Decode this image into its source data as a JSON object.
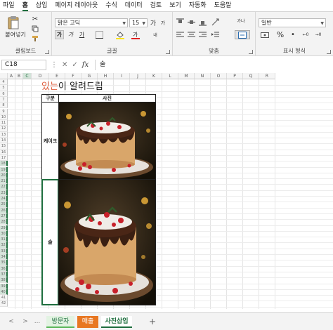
{
  "menu": [
    "파일",
    "홈",
    "삽입",
    "페이지 레이아웃",
    "수식",
    "데이터",
    "검토",
    "보기",
    "자동화",
    "도움말"
  ],
  "ribbon": {
    "clipboard_label": "클립보드",
    "paste_label": "붙여넣기",
    "font_label": "글꼴",
    "font_name": "맑은 고딕",
    "font_size": "15",
    "bold": "가",
    "italic": "가",
    "underline": "가",
    "grow_font": "가",
    "shrink_font": "가",
    "align_label": "맞춤",
    "wrap_text": "가나",
    "number_label": "표시 형식",
    "number_format": "일반",
    "percent": "%"
  },
  "formula_bar": {
    "name_box": "C18",
    "fx": "fx",
    "content": "술"
  },
  "columns": [
    "A",
    "B",
    "C",
    "D",
    "E",
    "F",
    "G",
    "H",
    "I",
    "J",
    "K",
    "L",
    "M",
    "N",
    "O",
    "P",
    "Q",
    "R"
  ],
  "rows": [
    "4",
    "5",
    "6",
    "7",
    "8",
    "9",
    "10",
    "11",
    "12",
    "13",
    "14",
    "15",
    "16",
    "17",
    "18",
    "19",
    "20",
    "21",
    "22",
    "23",
    "24",
    "25",
    "26",
    "27",
    "28",
    "29",
    "30",
    "31",
    "32",
    "33",
    "34",
    "35",
    "36",
    "37",
    "38",
    "39",
    "40",
    "41",
    "42"
  ],
  "sheet": {
    "title_highlight": "있는",
    "title_rest": "이 알려드림",
    "header_category": "구분",
    "header_photo": "사진",
    "row1_label": "케이크",
    "row2_label": "술"
  },
  "tabs": {
    "prev": "<",
    "next": ">",
    "more": "...",
    "add": "+",
    "items": [
      "방문자",
      "매출",
      "사진삽입"
    ],
    "colors": [
      "#5cb85c",
      "#e87722",
      "#1e6e3e"
    ]
  }
}
